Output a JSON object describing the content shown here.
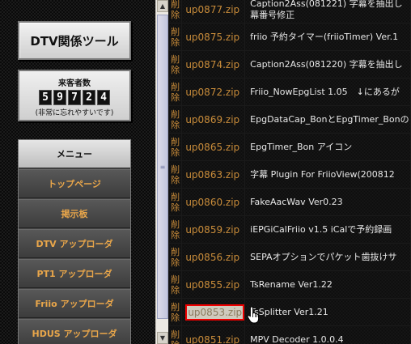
{
  "sidebar": {
    "title": "DTV関係ツール",
    "counter": {
      "label": "来客者数",
      "digits": [
        "5",
        "9",
        "7",
        "2",
        "4"
      ],
      "note": "(非常に忘れやすいです)"
    },
    "menu": {
      "header": "メニュー",
      "items": [
        {
          "label": "トップページ"
        },
        {
          "label": "掲示板"
        },
        {
          "label": "DTV アップローダ"
        },
        {
          "label": "PT1 アップローダ"
        },
        {
          "label": "Friio アップローダ"
        },
        {
          "label": "HDUS アップローダ"
        }
      ]
    }
  },
  "files": {
    "delete_label": [
      "削",
      "除"
    ],
    "rows": [
      {
        "file": "up0877.zip",
        "desc": [
          "Caption2Ass(081221) 字幕を抽出し",
          "幕番号修正"
        ]
      },
      {
        "file": "up0875.zip",
        "desc": [
          "friio 予約タイマー(friioTimer) Ver.1"
        ]
      },
      {
        "file": "up0874.zip",
        "desc": [
          "Caption2Ass(081220) 字幕を抽出し"
        ]
      },
      {
        "file": "up0872.zip",
        "desc": [
          "Friio_NowEpgList 1.05　↓にあるが"
        ]
      },
      {
        "file": "up0869.zip",
        "desc": [
          "EpgDataCap_BonとEpgTimer_Bonの"
        ]
      },
      {
        "file": "up0865.zip",
        "desc": [
          "EpgTimer_Bon アイコン"
        ]
      },
      {
        "file": "up0863.zip",
        "desc": [
          "字幕 Plugin For FriioView(200812"
        ]
      },
      {
        "file": "up0860.zip",
        "desc": [
          "FakeAacWav Ver0.23"
        ]
      },
      {
        "file": "up0859.zip",
        "desc": [
          "iEPGiCalFriio v1.5 iCalで予約録画"
        ]
      },
      {
        "file": "up0856.zip",
        "desc": [
          "SEPAオプションでパケット歯抜けサ"
        ]
      },
      {
        "file": "up0855.zip",
        "desc": [
          "TsRename Ver1.22"
        ]
      },
      {
        "file": "up0853.zip",
        "desc": [
          "TsSplitter Ver1.21"
        ],
        "selected": true
      },
      {
        "file": "up0851.zip",
        "desc": [
          "MPV Decoder 1.0.0.4"
        ]
      }
    ]
  },
  "colors": {
    "accent": "#e9a64a",
    "link": "#c98c3a",
    "selection_border": "#ee0000"
  }
}
